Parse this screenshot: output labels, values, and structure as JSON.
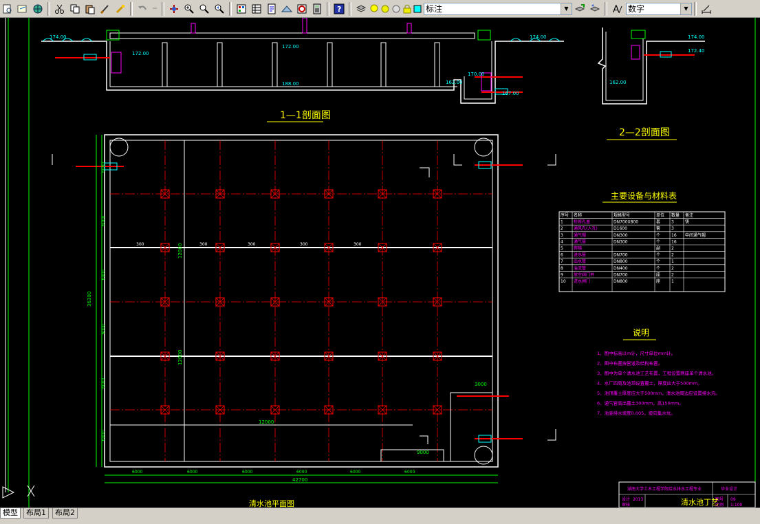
{
  "toolbar": {
    "layer_combo_value": "标注",
    "text_style_combo_value": "数字"
  },
  "drawing": {
    "section_1_1_title": "1—1剖面图",
    "section_2_2_title": "2—2剖面图",
    "plan_title": "清水池平面图",
    "equipment_table_title": "主要设备与材料表",
    "notes_title": "说明",
    "elev_top_left": "174.00",
    "elev_pipe_left": "172.00",
    "elev_bottom": "188.00",
    "elev_top_right": "174.00",
    "elev_pipe_right": "172.00",
    "elev_step": "170.00",
    "elev_small": "162.00",
    "elev_small2": "167.00",
    "elev_s2_top": "174.00",
    "elev_s2_pipe": "172.40",
    "elev_s2_bottom": "162.00",
    "total_width": "42700",
    "total_height": "36300",
    "dim_12000_a": "12000",
    "dim_12000_b": "12000",
    "dim_12000_c": "12000",
    "dim_3000": "3000",
    "dim_9000": "9000",
    "bay_dims": [
      "6000",
      "6000",
      "6000",
      "6000",
      "6000",
      "6000"
    ],
    "row_dims": [
      "6000",
      "6000",
      "6000",
      "6000",
      "6000",
      "6000"
    ],
    "pipe_300": [
      "300",
      "300",
      "300",
      "300",
      "300"
    ],
    "title_block_cells": [
      "湖南大学土木工程学院给水排水工程专业",
      "毕业设计",
      "设计",
      "2013",
      "图号",
      "09",
      "审核",
      "比例",
      "1:100"
    ],
    "sheet_name": "清水池丁艺"
  },
  "equipment_table": {
    "headers": [
      "序号",
      "名称",
      "规格型号",
      "单位",
      "数量",
      "备注"
    ],
    "rows": [
      [
        "1",
        "检修孔盖",
        "DN700X800",
        "套",
        "3",
        "铸"
      ],
      [
        "2",
        "通风孔(人孔)",
        "D1600",
        "套",
        "3",
        ""
      ],
      [
        "3",
        "通气帽",
        "DN300",
        "个",
        "16",
        "中间通气帽"
      ],
      [
        "4",
        "通气管",
        "DN300",
        "个",
        "16",
        ""
      ],
      [
        "5",
        "爬梯",
        "",
        "副",
        "2",
        ""
      ],
      [
        "6",
        "进水管",
        "DN700",
        "个",
        "2",
        ""
      ],
      [
        "7",
        "出水管",
        "DN800",
        "个",
        "1",
        ""
      ],
      [
        "8",
        "溢流管",
        "DN400",
        "个",
        "2",
        ""
      ],
      [
        "9",
        "放空阀门井",
        "DN700",
        "座",
        "2",
        ""
      ],
      [
        "10",
        "进水闸门",
        "DN800",
        "座",
        "1",
        ""
      ]
    ]
  },
  "notes": [
    "1、图中标高以m计，尺寸单位mm计。",
    "2、图中布置按管道及结构布置。",
    "3、图中为单个清水池工艺布置，工程设置两座单个清水池。",
    "4、水厂四周及池顶设置覆土，厚度应大于500mm。",
    "5、池顶覆土厚度应大于500mm，清水池周边应设置排水沟。",
    "6、通气管高出覆土300mm，高150mm。",
    "7、池底排水坡度0.005，坡向集水坑。"
  ],
  "tabs": [
    "模型",
    "布局1",
    "布局2"
  ],
  "colors": {
    "red": "#ff0000",
    "white": "#ffffff",
    "green": "#00ff00",
    "cyan": "#00ffff",
    "magenta": "#ff00ff",
    "yellow": "#ffff00",
    "blue": "#0000ff"
  }
}
